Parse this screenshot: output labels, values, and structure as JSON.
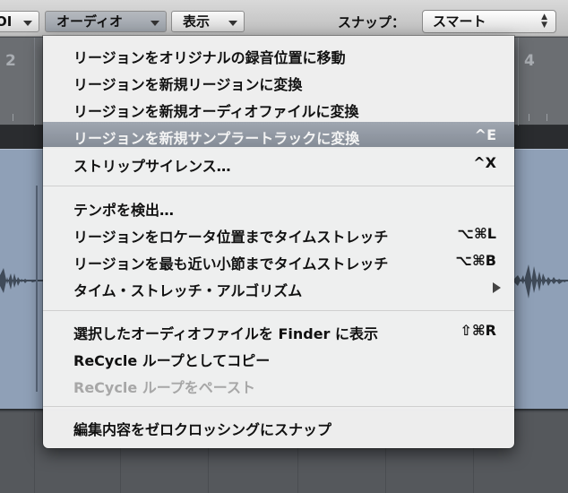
{
  "toolbar": {
    "midi_partial": "OI",
    "audio_menu": "オーディオ",
    "view_menu": "表示",
    "snap_label": "スナップ：",
    "snap_value": "スマート"
  },
  "ruler": {
    "left_number": "2",
    "right_number": "4"
  },
  "menu": {
    "group1": [
      {
        "label": "リージョンをオリジナルの録音位置に移動",
        "shortcut": ""
      },
      {
        "label": "リージョンを新規リージョンに変換",
        "shortcut": ""
      },
      {
        "label": "リージョンを新規オーディオファイルに変換",
        "shortcut": ""
      },
      {
        "label": "リージョンを新規サンプラートラックに変換",
        "shortcut": "^E"
      },
      {
        "label": "ストリップサイレンス…",
        "shortcut": "^X"
      }
    ],
    "group2": [
      {
        "label": "テンポを検出…",
        "shortcut": ""
      },
      {
        "label": "リージョンをロケータ位置までタイムストレッチ",
        "shortcut": "⌥⌘L"
      },
      {
        "label": "リージョンを最も近い小節までタイムストレッチ",
        "shortcut": "⌥⌘B"
      },
      {
        "label": "タイム・ストレッチ・アルゴリズム",
        "shortcut": ""
      }
    ],
    "group3": [
      {
        "label": "選択したオーディオファイルを Finder に表示",
        "shortcut": "⇧⌘R"
      },
      {
        "label": "ReCycle ループとしてコピー",
        "shortcut": ""
      },
      {
        "label": "ReCycle ループをペースト",
        "shortcut": ""
      }
    ],
    "group4": [
      {
        "label": "編集内容をゼロクロッシングにスナップ",
        "shortcut": ""
      }
    ]
  },
  "colors": {
    "menu_background": "#f0f0f0",
    "highlight": "#8f96a1",
    "region": "#8fa0b7",
    "disabled_text": "#a7a7a7"
  }
}
